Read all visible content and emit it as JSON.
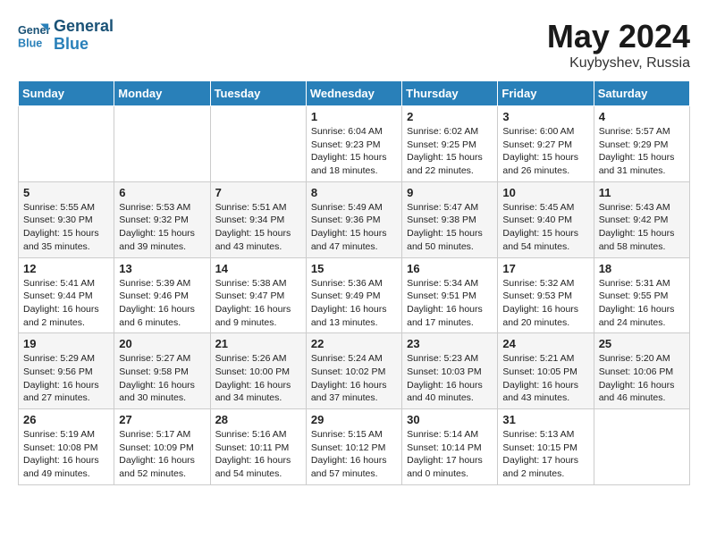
{
  "header": {
    "logo_line1": "General",
    "logo_line2": "Blue",
    "month_year": "May 2024",
    "location": "Kuybyshev, Russia"
  },
  "weekdays": [
    "Sunday",
    "Monday",
    "Tuesday",
    "Wednesday",
    "Thursday",
    "Friday",
    "Saturday"
  ],
  "weeks": [
    [
      {
        "day": "",
        "info": ""
      },
      {
        "day": "",
        "info": ""
      },
      {
        "day": "",
        "info": ""
      },
      {
        "day": "1",
        "info": "Sunrise: 6:04 AM\nSunset: 9:23 PM\nDaylight: 15 hours\nand 18 minutes."
      },
      {
        "day": "2",
        "info": "Sunrise: 6:02 AM\nSunset: 9:25 PM\nDaylight: 15 hours\nand 22 minutes."
      },
      {
        "day": "3",
        "info": "Sunrise: 6:00 AM\nSunset: 9:27 PM\nDaylight: 15 hours\nand 26 minutes."
      },
      {
        "day": "4",
        "info": "Sunrise: 5:57 AM\nSunset: 9:29 PM\nDaylight: 15 hours\nand 31 minutes."
      }
    ],
    [
      {
        "day": "5",
        "info": "Sunrise: 5:55 AM\nSunset: 9:30 PM\nDaylight: 15 hours\nand 35 minutes."
      },
      {
        "day": "6",
        "info": "Sunrise: 5:53 AM\nSunset: 9:32 PM\nDaylight: 15 hours\nand 39 minutes."
      },
      {
        "day": "7",
        "info": "Sunrise: 5:51 AM\nSunset: 9:34 PM\nDaylight: 15 hours\nand 43 minutes."
      },
      {
        "day": "8",
        "info": "Sunrise: 5:49 AM\nSunset: 9:36 PM\nDaylight: 15 hours\nand 47 minutes."
      },
      {
        "day": "9",
        "info": "Sunrise: 5:47 AM\nSunset: 9:38 PM\nDaylight: 15 hours\nand 50 minutes."
      },
      {
        "day": "10",
        "info": "Sunrise: 5:45 AM\nSunset: 9:40 PM\nDaylight: 15 hours\nand 54 minutes."
      },
      {
        "day": "11",
        "info": "Sunrise: 5:43 AM\nSunset: 9:42 PM\nDaylight: 15 hours\nand 58 minutes."
      }
    ],
    [
      {
        "day": "12",
        "info": "Sunrise: 5:41 AM\nSunset: 9:44 PM\nDaylight: 16 hours\nand 2 minutes."
      },
      {
        "day": "13",
        "info": "Sunrise: 5:39 AM\nSunset: 9:46 PM\nDaylight: 16 hours\nand 6 minutes."
      },
      {
        "day": "14",
        "info": "Sunrise: 5:38 AM\nSunset: 9:47 PM\nDaylight: 16 hours\nand 9 minutes."
      },
      {
        "day": "15",
        "info": "Sunrise: 5:36 AM\nSunset: 9:49 PM\nDaylight: 16 hours\nand 13 minutes."
      },
      {
        "day": "16",
        "info": "Sunrise: 5:34 AM\nSunset: 9:51 PM\nDaylight: 16 hours\nand 17 minutes."
      },
      {
        "day": "17",
        "info": "Sunrise: 5:32 AM\nSunset: 9:53 PM\nDaylight: 16 hours\nand 20 minutes."
      },
      {
        "day": "18",
        "info": "Sunrise: 5:31 AM\nSunset: 9:55 PM\nDaylight: 16 hours\nand 24 minutes."
      }
    ],
    [
      {
        "day": "19",
        "info": "Sunrise: 5:29 AM\nSunset: 9:56 PM\nDaylight: 16 hours\nand 27 minutes."
      },
      {
        "day": "20",
        "info": "Sunrise: 5:27 AM\nSunset: 9:58 PM\nDaylight: 16 hours\nand 30 minutes."
      },
      {
        "day": "21",
        "info": "Sunrise: 5:26 AM\nSunset: 10:00 PM\nDaylight: 16 hours\nand 34 minutes."
      },
      {
        "day": "22",
        "info": "Sunrise: 5:24 AM\nSunset: 10:02 PM\nDaylight: 16 hours\nand 37 minutes."
      },
      {
        "day": "23",
        "info": "Sunrise: 5:23 AM\nSunset: 10:03 PM\nDaylight: 16 hours\nand 40 minutes."
      },
      {
        "day": "24",
        "info": "Sunrise: 5:21 AM\nSunset: 10:05 PM\nDaylight: 16 hours\nand 43 minutes."
      },
      {
        "day": "25",
        "info": "Sunrise: 5:20 AM\nSunset: 10:06 PM\nDaylight: 16 hours\nand 46 minutes."
      }
    ],
    [
      {
        "day": "26",
        "info": "Sunrise: 5:19 AM\nSunset: 10:08 PM\nDaylight: 16 hours\nand 49 minutes."
      },
      {
        "day": "27",
        "info": "Sunrise: 5:17 AM\nSunset: 10:09 PM\nDaylight: 16 hours\nand 52 minutes."
      },
      {
        "day": "28",
        "info": "Sunrise: 5:16 AM\nSunset: 10:11 PM\nDaylight: 16 hours\nand 54 minutes."
      },
      {
        "day": "29",
        "info": "Sunrise: 5:15 AM\nSunset: 10:12 PM\nDaylight: 16 hours\nand 57 minutes."
      },
      {
        "day": "30",
        "info": "Sunrise: 5:14 AM\nSunset: 10:14 PM\nDaylight: 17 hours\nand 0 minutes."
      },
      {
        "day": "31",
        "info": "Sunrise: 5:13 AM\nSunset: 10:15 PM\nDaylight: 17 hours\nand 2 minutes."
      },
      {
        "day": "",
        "info": ""
      }
    ]
  ]
}
